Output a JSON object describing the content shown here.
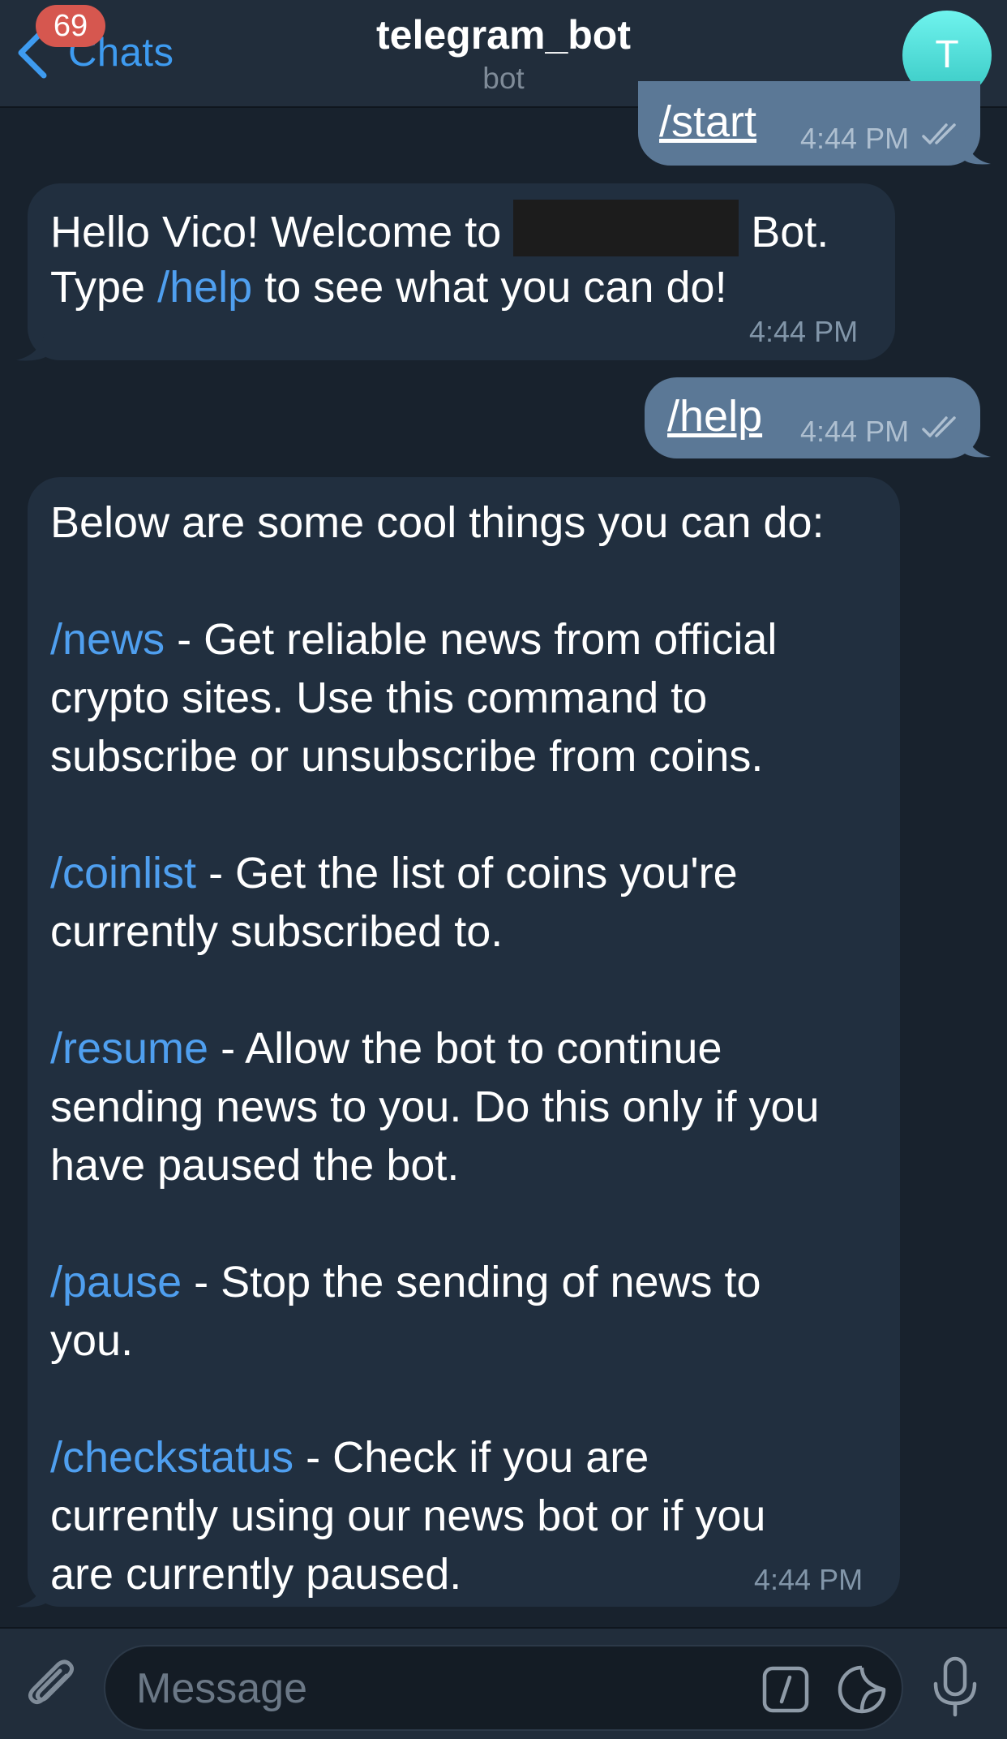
{
  "header": {
    "back_label": "Chats",
    "unread_count": "69",
    "title": "telegram_bot",
    "subtitle": "bot",
    "avatar_letter": "T"
  },
  "messages": [
    {
      "id": "m1",
      "direction": "outgoing",
      "text": "/start",
      "time": "4:44 PM",
      "status": "read"
    },
    {
      "id": "m2",
      "direction": "incoming",
      "line1_a": "Hello Vico! Welcome to ",
      "line1_b": " Bot.",
      "line2_a": "Type ",
      "line2_link": "/help",
      "line2_b": " to see what you can do!",
      "time": "4:44 PM"
    },
    {
      "id": "m3",
      "direction": "outgoing",
      "text": "/help",
      "time": "4:44 PM",
      "status": "read"
    },
    {
      "id": "m4",
      "direction": "incoming",
      "intro": "Below are some cool things you can do:",
      "items": [
        {
          "cmd": "/news",
          "desc": " - Get reliable news from official\ncrypto sites. Use this command to\nsubscribe or unsubscribe from coins."
        },
        {
          "cmd": "/coinlist",
          "desc": " - Get the list of coins you're\ncurrently subscribed to."
        },
        {
          "cmd": "/resume",
          "desc": " - Allow the bot to continue\nsending news to you. Do this only if you\nhave paused the bot."
        },
        {
          "cmd": "/pause",
          "desc": " - Stop the sending of news to\nyou."
        },
        {
          "cmd": "/checkstatus",
          "desc": " - Check if you are\ncurrently using our news bot or if you\nare currently paused."
        }
      ],
      "time": "4:44 PM"
    }
  ],
  "composer": {
    "placeholder": "Message"
  },
  "colors": {
    "background": "#18222d",
    "header": "#212d3b",
    "incoming_bubble": "#212f3f",
    "outgoing_bubble": "#5b7896",
    "link": "#4f9fef",
    "badge": "#d6574f",
    "avatar": "#4fd8d3"
  },
  "icons": [
    "chevron-left-icon",
    "paperclip-icon",
    "bot-command-icon",
    "sticker-icon",
    "microphone-icon",
    "double-check-icon"
  ]
}
